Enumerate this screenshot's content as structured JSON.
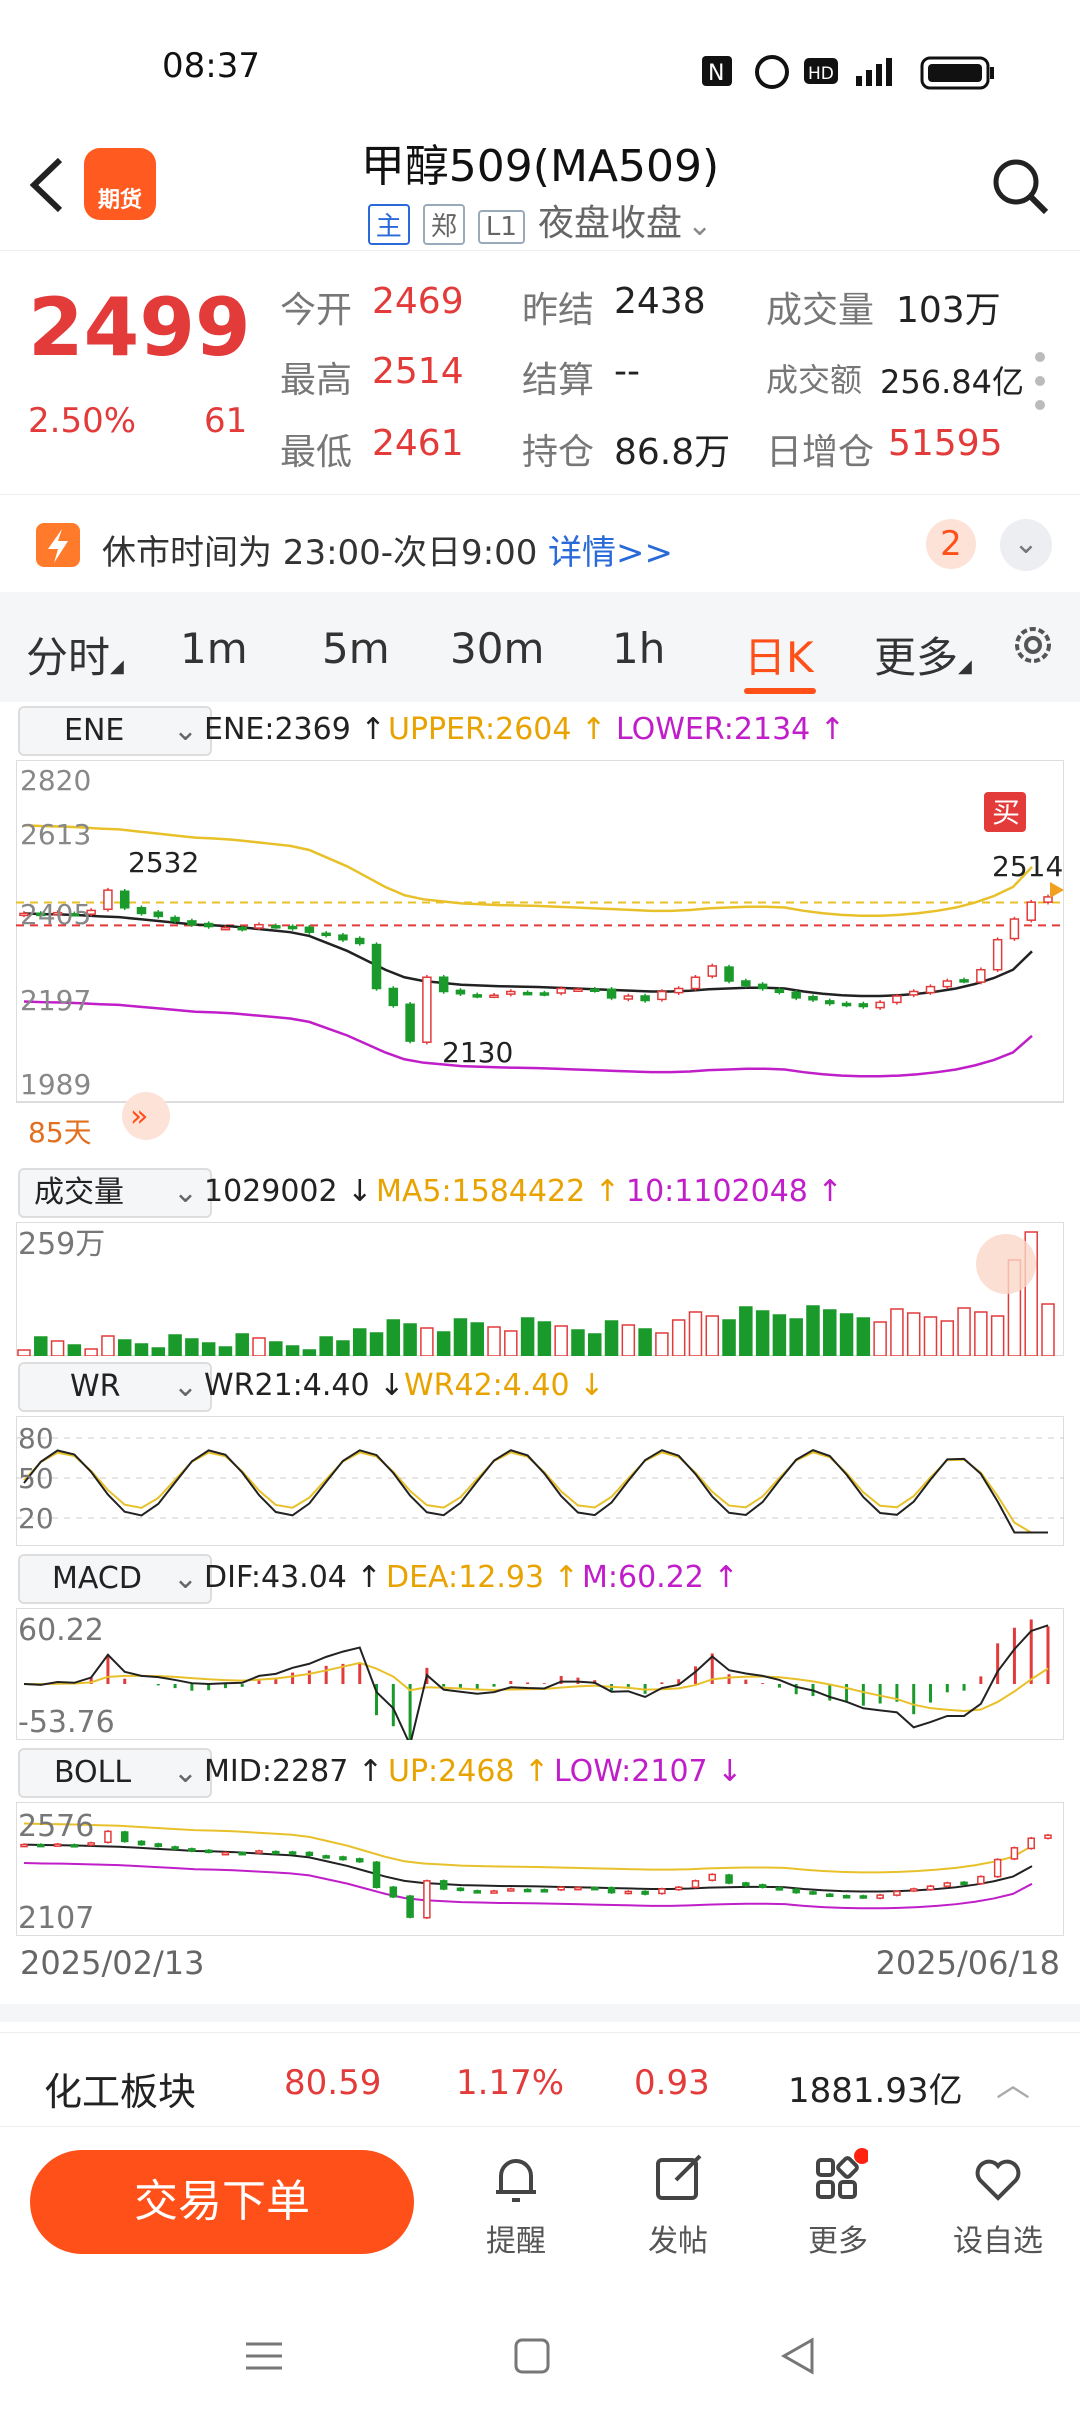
{
  "status_bar": {
    "time": "08:37",
    "icons": [
      "nfc-icon",
      "alarm-icon",
      "hd-icon",
      "5g-signal-icon",
      "battery-icon"
    ]
  },
  "header": {
    "title": "甲醇509(MA509)",
    "tags": [
      "主",
      "郑",
      "L1"
    ],
    "session": "夜盘收盘",
    "logo_text": "期货"
  },
  "quote": {
    "price": "2499",
    "change_pct": "2.50%",
    "change": "61",
    "open_label": "今开",
    "open": "2469",
    "high_label": "最高",
    "high": "2514",
    "low_label": "最低",
    "low": "2461",
    "prev_settle_label": "昨结",
    "prev_settle": "2438",
    "settle_label": "结算",
    "settle": "--",
    "oi_label": "持仓",
    "oi": "86.8万",
    "volume_label": "成交量",
    "volume": "103万",
    "turnover_label": "成交额",
    "turnover": "256.84亿",
    "oi_change_label": "日增仓",
    "oi_change": "51595"
  },
  "notice": {
    "text": "休市时间为 23:00-次日9:00",
    "link": "详情>>",
    "badge": "2"
  },
  "tabs": [
    "分时",
    "1m",
    "5m",
    "30m",
    "1h",
    "日K",
    "更多"
  ],
  "active_tab": "日K",
  "colors": {
    "up": "#e33a3a",
    "down": "#1a9a2a",
    "upper": "#e8c02a",
    "lower": "#c01ec8",
    "accent": "#ff5019"
  },
  "ene": {
    "selector": "ENE",
    "value": "ENE:2369",
    "upper": "UPPER:2604",
    "lower": "LOWER:2134",
    "y_ticks": [
      "2820",
      "2613",
      "2405",
      "2197",
      "1989"
    ],
    "label_high": "2532",
    "label_low": "2130",
    "label_last": "2514",
    "buy_mark": "买",
    "days": "85天"
  },
  "volume_panel": {
    "selector": "成交量",
    "value": "1029002",
    "ma5": "MA5:1584422",
    "ma10": "10:1102048",
    "y_tick": "259万"
  },
  "wr_panel": {
    "selector": "WR",
    "wr21": "WR21:4.40",
    "wr42": "WR42:4.40",
    "y_ticks": [
      "80",
      "50",
      "20"
    ]
  },
  "macd_panel": {
    "selector": "MACD",
    "dif": "DIF:43.04",
    "dea": "DEA:12.93",
    "m": "M:60.22",
    "y_ticks": [
      "60.22",
      "-53.76"
    ]
  },
  "boll_panel": {
    "selector": "BOLL",
    "mid": "MID:2287",
    "up": "UP:2468",
    "low": "LOW:2107",
    "y_ticks": [
      "2576",
      "2107"
    ]
  },
  "date_range": {
    "start": "2025/02/13",
    "end": "2025/06/18"
  },
  "sector": {
    "name": "化工板块",
    "value": "80.59",
    "pct": "1.17%",
    "change": "0.93",
    "turnover": "1881.93亿"
  },
  "bottom_nav": {
    "trade": "交易下单",
    "items": [
      "提醒",
      "发帖",
      "更多",
      "设自选"
    ]
  },
  "chart_data": {
    "type": "candlestick",
    "price_closes": [
      2470,
      2466,
      2472,
      2468,
      2478,
      2532,
      2485,
      2470,
      2462,
      2450,
      2440,
      2435,
      2432,
      2428,
      2440,
      2435,
      2430,
      2420,
      2412,
      2400,
      2390,
      2270,
      2225,
      2130,
      2300,
      2262,
      2256,
      2250,
      2252,
      2262,
      2258,
      2255,
      2270,
      2268,
      2265,
      2245,
      2250,
      2238,
      2262,
      2270,
      2300,
      2330,
      2290,
      2278,
      2270,
      2260,
      2245,
      2240,
      2230,
      2226,
      2222,
      2233,
      2250,
      2262,
      2275,
      2290,
      2290,
      2320,
      2400,
      2455,
      2500,
      2514
    ],
    "ene_mid": [
      2470,
      2468,
      2467,
      2465,
      2462,
      2460,
      2455,
      2450,
      2445,
      2440,
      2438,
      2435,
      2430,
      2425,
      2420,
      2410,
      2390,
      2370,
      2345,
      2320,
      2300,
      2290,
      2285,
      2280,
      2278,
      2276,
      2275,
      2274,
      2272,
      2270,
      2268,
      2266,
      2264,
      2262,
      2262,
      2264,
      2268,
      2270,
      2272,
      2272,
      2270,
      2262,
      2256,
      2252,
      2250,
      2250,
      2252,
      2256,
      2262,
      2270,
      2282,
      2298,
      2320,
      2369
    ]
  }
}
